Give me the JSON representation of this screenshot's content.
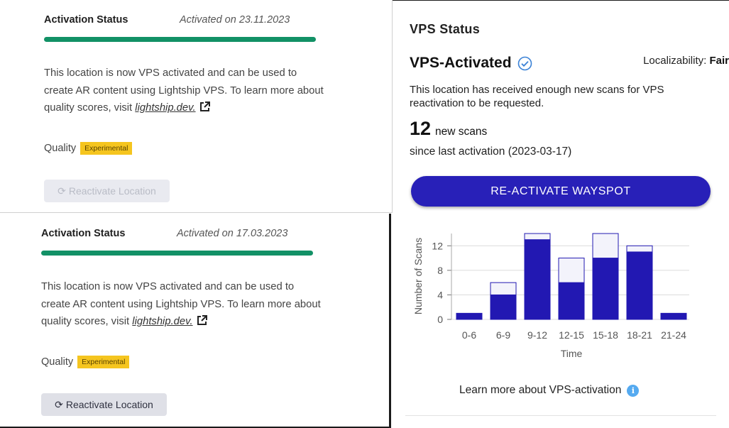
{
  "card1": {
    "title": "Activation Status",
    "date": "Activated on 23.11.2023",
    "desc_text": "This location is now VPS activated and can be used to create AR content using Lightship VPS. To learn more about quality scores, visit ",
    "link": "lightship.dev.",
    "quality_label": "Quality",
    "badge": "Experimental",
    "button": "Reactivate Location",
    "button_state": "disabled"
  },
  "card2": {
    "title": "Activation Status",
    "date": "Activated on 17.03.2023",
    "desc_text": "This location is now VPS activated and can be used to create AR content using Lightship VPS. To learn more about quality scores, visit ",
    "link": "lightship.dev.",
    "quality_label": "Quality",
    "badge": "Experimental",
    "button": "Reactivate Location",
    "button_state": "enabled"
  },
  "vps": {
    "heading": "VPS Status",
    "activated": "VPS-Activated",
    "localizability_label": "Localizability:",
    "localizability_value": "Fair",
    "desc": "This location has received enough new scans for VPS reactivation to be requested.",
    "scan_number": "12",
    "scan_label": "new scans",
    "since": "since last activation (2023-03-17)",
    "button": "RE-ACTIVATE WAYSPOT",
    "learn_more": "Learn more about VPS-activation"
  },
  "colors": {
    "progress": "#129166",
    "badge": "#f5c51f",
    "primary": "#2820b8",
    "info": "#55aaf0"
  },
  "chart_data": {
    "type": "bar",
    "stacked": true,
    "categories": [
      "0-6",
      "6-9",
      "9-12",
      "12-15",
      "15-18",
      "18-21",
      "21-24"
    ],
    "series": [
      {
        "values": [
          1,
          4,
          13,
          6,
          10,
          11,
          1
        ],
        "color": "#2218b2"
      },
      {
        "values": [
          0,
          2,
          1,
          4,
          4,
          1,
          0
        ],
        "color": "#f3f3fb"
      }
    ],
    "xlabel": "Time",
    "ylabel": "Number of Scans",
    "ylim": [
      0,
      14
    ],
    "yticks": [
      0,
      4,
      8,
      12
    ],
    "grid": true
  }
}
